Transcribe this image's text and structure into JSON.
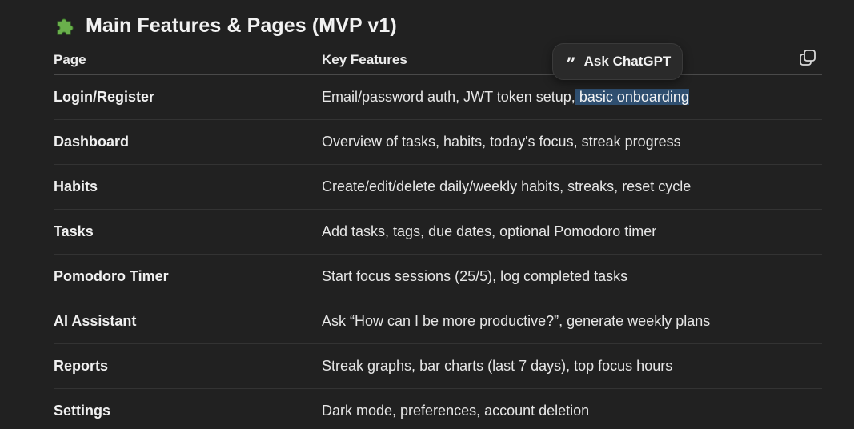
{
  "section": {
    "icon": "puzzle-piece-icon",
    "title": "Main Features & Pages (MVP v1)"
  },
  "table": {
    "headers": [
      "Page",
      "Key Features"
    ],
    "rows": [
      {
        "page": "Login/Register",
        "features_before": "Email/password auth, JWT token setup,",
        "features_selected": " basic onboarding"
      },
      {
        "page": "Dashboard",
        "features": "Overview of tasks, habits, today's focus, streak progress"
      },
      {
        "page": "Habits",
        "features": "Create/edit/delete daily/weekly habits, streaks, reset cycle"
      },
      {
        "page": "Tasks",
        "features": "Add tasks, tags, due dates, optional Pomodoro timer"
      },
      {
        "page": "Pomodoro Timer",
        "features": "Start focus sessions (25/5), log completed tasks"
      },
      {
        "page": "AI Assistant",
        "features": "Ask “How can I be more productive?”, generate weekly plans"
      },
      {
        "page": "Reports",
        "features": "Streak graphs, bar charts (last 7 days), top focus hours"
      },
      {
        "page": "Settings",
        "features": "Dark mode, preferences, account deletion"
      }
    ]
  },
  "ask_popup": {
    "quote_glyph": "”",
    "label": "Ask ChatGPT"
  },
  "copy": {
    "icon": "copy-icon"
  },
  "colors": {
    "background": "#212121",
    "selection": "#2f4f70",
    "puzzle_green": "#6ab04c"
  }
}
